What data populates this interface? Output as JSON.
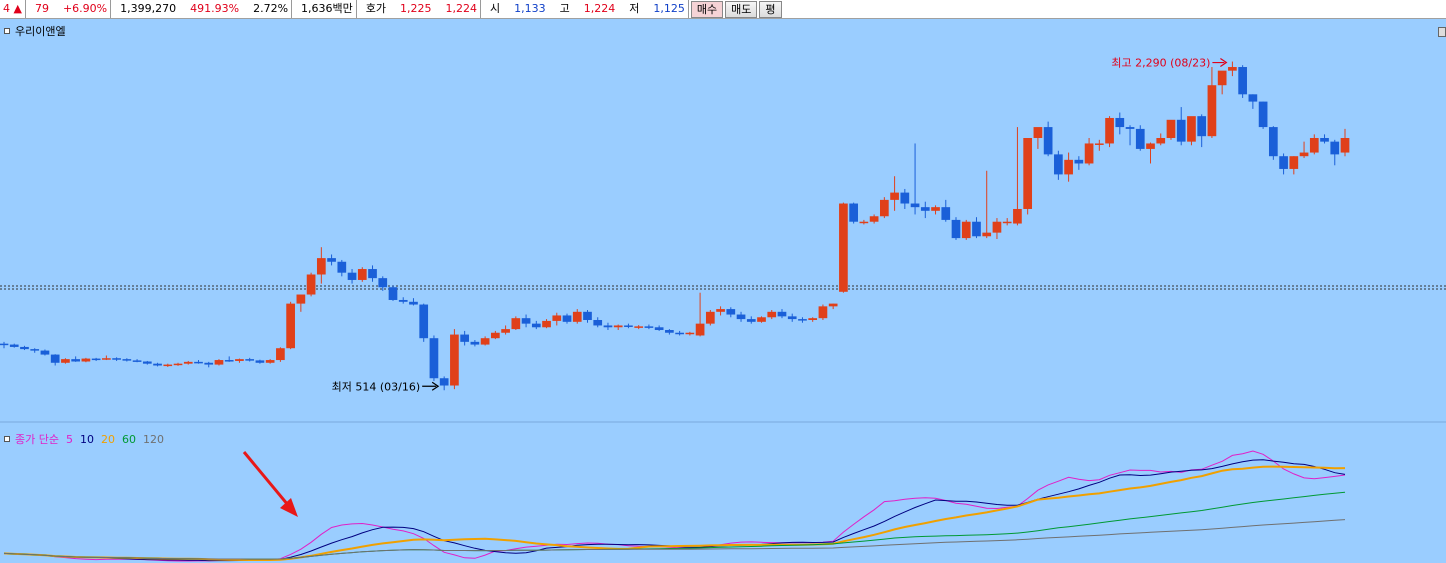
{
  "topbar": {
    "cells": [
      {
        "name": "change-arrow-cell",
        "parts": [
          {
            "t": "4 ▲",
            "c": "red"
          }
        ]
      },
      {
        "name": "change-cell",
        "parts": [
          {
            "t": "79",
            "c": "red"
          },
          {
            "t": "+6.90%",
            "c": "red"
          }
        ]
      },
      {
        "name": "volume-cell",
        "parts": [
          {
            "t": "1,399,270",
            "c": ""
          },
          {
            "t": "491.93%",
            "c": "red"
          },
          {
            "t": "2.72%",
            "c": ""
          }
        ]
      },
      {
        "name": "amount-cell",
        "parts": [
          {
            "t": "1,636백만",
            "c": ""
          }
        ]
      },
      {
        "name": "quote-cell",
        "parts": [
          {
            "t": "호가",
            "c": ""
          },
          {
            "t": "1,225",
            "c": "red"
          },
          {
            "t": "1,224",
            "c": "red"
          }
        ]
      },
      {
        "name": "ohl-cell",
        "parts": [
          {
            "t": "시",
            "c": ""
          },
          {
            "t": "1,133",
            "c": "blue"
          },
          {
            "t": "고",
            "c": ""
          },
          {
            "t": "1,224",
            "c": "red"
          },
          {
            "t": "저",
            "c": ""
          },
          {
            "t": "1,125",
            "c": "blue"
          }
        ]
      }
    ],
    "buttons": {
      "buy": "매수",
      "sell": "매도",
      "avg": "평"
    }
  },
  "price_panel": {
    "title": "우리이앤엘"
  },
  "ma_panel": {
    "title": "종가 단순",
    "periods": [
      {
        "label": "5",
        "color": "#e020c8"
      },
      {
        "label": "10",
        "color": "#000080"
      },
      {
        "label": "20",
        "color": "#f0a000"
      },
      {
        "label": "60",
        "color": "#009933"
      },
      {
        "label": "120",
        "color": "#707070"
      }
    ]
  },
  "colors": {
    "up": "#e0401a",
    "down": "#1a5fd8",
    "background": "#9acdff",
    "high_label": "#e0001a",
    "low_label": "#000000"
  },
  "chart_data": {
    "type": "candlestick",
    "title": "우리이앤엘",
    "price_range": [
      400,
      2400
    ],
    "annotations": {
      "high": {
        "label": "최고 2,290 (08/23)",
        "value": 2290
      },
      "low": {
        "label": "최저 514 (03/16)",
        "value": 514
      }
    },
    "reference_line": 1085,
    "candles": [
      [
        770,
        780,
        745,
        765
      ],
      [
        765,
        770,
        748,
        752
      ],
      [
        752,
        758,
        735,
        740
      ],
      [
        740,
        745,
        720,
        732
      ],
      [
        732,
        738,
        705,
        710
      ],
      [
        710,
        712,
        650,
        665
      ],
      [
        665,
        690,
        660,
        685
      ],
      [
        685,
        700,
        670,
        672
      ],
      [
        672,
        692,
        668,
        688
      ],
      [
        688,
        692,
        675,
        685
      ],
      [
        690,
        705,
        680,
        690
      ],
      [
        690,
        695,
        675,
        685
      ],
      [
        685,
        690,
        672,
        678
      ],
      [
        678,
        685,
        668,
        672
      ],
      [
        672,
        675,
        655,
        660
      ],
      [
        660,
        665,
        645,
        650
      ],
      [
        650,
        660,
        642,
        655
      ],
      [
        655,
        665,
        648,
        660
      ],
      [
        660,
        675,
        655,
        670
      ],
      [
        670,
        680,
        660,
        665
      ],
      [
        665,
        670,
        640,
        655
      ],
      [
        655,
        685,
        650,
        680
      ],
      [
        680,
        700,
        670,
        675
      ],
      [
        675,
        688,
        665,
        685
      ],
      [
        685,
        692,
        672,
        678
      ],
      [
        678,
        682,
        660,
        665
      ],
      [
        665,
        685,
        660,
        680
      ],
      [
        680,
        750,
        670,
        745
      ],
      [
        745,
        1000,
        740,
        990
      ],
      [
        990,
        1035,
        945,
        1040
      ],
      [
        1040,
        1160,
        1030,
        1150
      ],
      [
        1150,
        1300,
        1100,
        1240
      ],
      [
        1240,
        1260,
        1200,
        1220
      ],
      [
        1220,
        1230,
        1140,
        1160
      ],
      [
        1160,
        1180,
        1100,
        1120
      ],
      [
        1120,
        1190,
        1110,
        1180
      ],
      [
        1180,
        1200,
        1110,
        1130
      ],
      [
        1130,
        1140,
        1060,
        1080
      ],
      [
        1080,
        1090,
        1005,
        1010
      ],
      [
        1010,
        1025,
        990,
        1000
      ],
      [
        1000,
        1020,
        980,
        985
      ],
      [
        985,
        990,
        780,
        800
      ],
      [
        800,
        815,
        565,
        580
      ],
      [
        580,
        590,
        514,
        540
      ],
      [
        540,
        850,
        520,
        820
      ],
      [
        820,
        840,
        760,
        780
      ],
      [
        780,
        790,
        755,
        765
      ],
      [
        765,
        810,
        760,
        800
      ],
      [
        800,
        840,
        795,
        830
      ],
      [
        830,
        870,
        820,
        850
      ],
      [
        850,
        920,
        845,
        910
      ],
      [
        910,
        930,
        860,
        880
      ],
      [
        880,
        895,
        850,
        860
      ],
      [
        860,
        905,
        855,
        895
      ],
      [
        895,
        940,
        870,
        925
      ],
      [
        925,
        935,
        880,
        890
      ],
      [
        890,
        960,
        880,
        945
      ],
      [
        945,
        955,
        885,
        900
      ],
      [
        900,
        915,
        860,
        870
      ],
      [
        870,
        885,
        845,
        860
      ],
      [
        860,
        875,
        845,
        870
      ],
      [
        870,
        880,
        855,
        862
      ],
      [
        862,
        872,
        850,
        865
      ],
      [
        865,
        875,
        850,
        860
      ],
      [
        860,
        870,
        840,
        845
      ],
      [
        845,
        850,
        820,
        830
      ],
      [
        830,
        840,
        815,
        822
      ],
      [
        822,
        835,
        815,
        830
      ],
      [
        815,
        1050,
        810,
        880
      ],
      [
        880,
        955,
        870,
        945
      ],
      [
        945,
        975,
        925,
        960
      ],
      [
        960,
        970,
        915,
        930
      ],
      [
        930,
        945,
        890,
        905
      ],
      [
        905,
        920,
        880,
        890
      ],
      [
        890,
        920,
        885,
        915
      ],
      [
        915,
        955,
        905,
        945
      ],
      [
        945,
        960,
        910,
        920
      ],
      [
        920,
        935,
        890,
        905
      ],
      [
        905,
        915,
        885,
        900
      ],
      [
        900,
        915,
        890,
        910
      ],
      [
        910,
        985,
        900,
        975
      ],
      [
        975,
        990,
        960,
        990
      ],
      [
        1055,
        1545,
        1050,
        1540
      ],
      [
        1540,
        1545,
        1430,
        1440
      ],
      [
        1440,
        1450,
        1425,
        1440
      ],
      [
        1440,
        1480,
        1430,
        1470
      ],
      [
        1470,
        1575,
        1460,
        1560
      ],
      [
        1560,
        1690,
        1500,
        1600
      ],
      [
        1600,
        1620,
        1510,
        1540
      ],
      [
        1540,
        1870,
        1480,
        1520
      ],
      [
        1520,
        1550,
        1460,
        1500
      ],
      [
        1500,
        1530,
        1480,
        1520
      ],
      [
        1520,
        1560,
        1440,
        1450
      ],
      [
        1450,
        1465,
        1340,
        1350
      ],
      [
        1350,
        1450,
        1340,
        1440
      ],
      [
        1440,
        1465,
        1350,
        1360
      ],
      [
        1360,
        1720,
        1350,
        1380
      ],
      [
        1380,
        1460,
        1345,
        1440
      ],
      [
        1440,
        1460,
        1420,
        1440
      ],
      [
        1430,
        1960,
        1420,
        1510
      ],
      [
        1510,
        1900,
        1480,
        1900
      ],
      [
        1900,
        1950,
        1840,
        1960
      ],
      [
        1960,
        1990,
        1800,
        1810
      ],
      [
        1810,
        1830,
        1670,
        1700
      ],
      [
        1700,
        1820,
        1660,
        1780
      ],
      [
        1780,
        1800,
        1725,
        1760
      ],
      [
        1760,
        1900,
        1750,
        1870
      ],
      [
        1870,
        1890,
        1830,
        1870
      ],
      [
        1870,
        2020,
        1850,
        2010
      ],
      [
        2010,
        2040,
        1920,
        1960
      ],
      [
        1960,
        1970,
        1860,
        1950
      ],
      [
        1950,
        1970,
        1830,
        1840
      ],
      [
        1840,
        1875,
        1760,
        1870
      ],
      [
        1870,
        1925,
        1860,
        1900
      ],
      [
        1900,
        1970,
        1890,
        2000
      ],
      [
        2000,
        2070,
        1860,
        1880
      ],
      [
        1880,
        1990,
        1860,
        2020
      ],
      [
        2020,
        2030,
        1850,
        1910
      ],
      [
        1910,
        2290,
        1900,
        2190
      ],
      [
        2190,
        2260,
        2140,
        2270
      ],
      [
        2270,
        2320,
        2240,
        2290
      ],
      [
        2290,
        2300,
        2120,
        2140
      ],
      [
        2140,
        2140,
        2060,
        2100
      ],
      [
        2100,
        2100,
        1950,
        1960
      ],
      [
        1960,
        1965,
        1780,
        1800
      ],
      [
        1800,
        1815,
        1700,
        1730
      ],
      [
        1730,
        1800,
        1700,
        1800
      ],
      [
        1800,
        1880,
        1790,
        1820
      ],
      [
        1820,
        1920,
        1810,
        1900
      ],
      [
        1900,
        1920,
        1870,
        1880
      ],
      [
        1880,
        1890,
        1750,
        1810
      ],
      [
        1820,
        1950,
        1800,
        1900
      ]
    ],
    "ma_series": {
      "periods": [
        5,
        10,
        20,
        60,
        120
      ]
    }
  }
}
